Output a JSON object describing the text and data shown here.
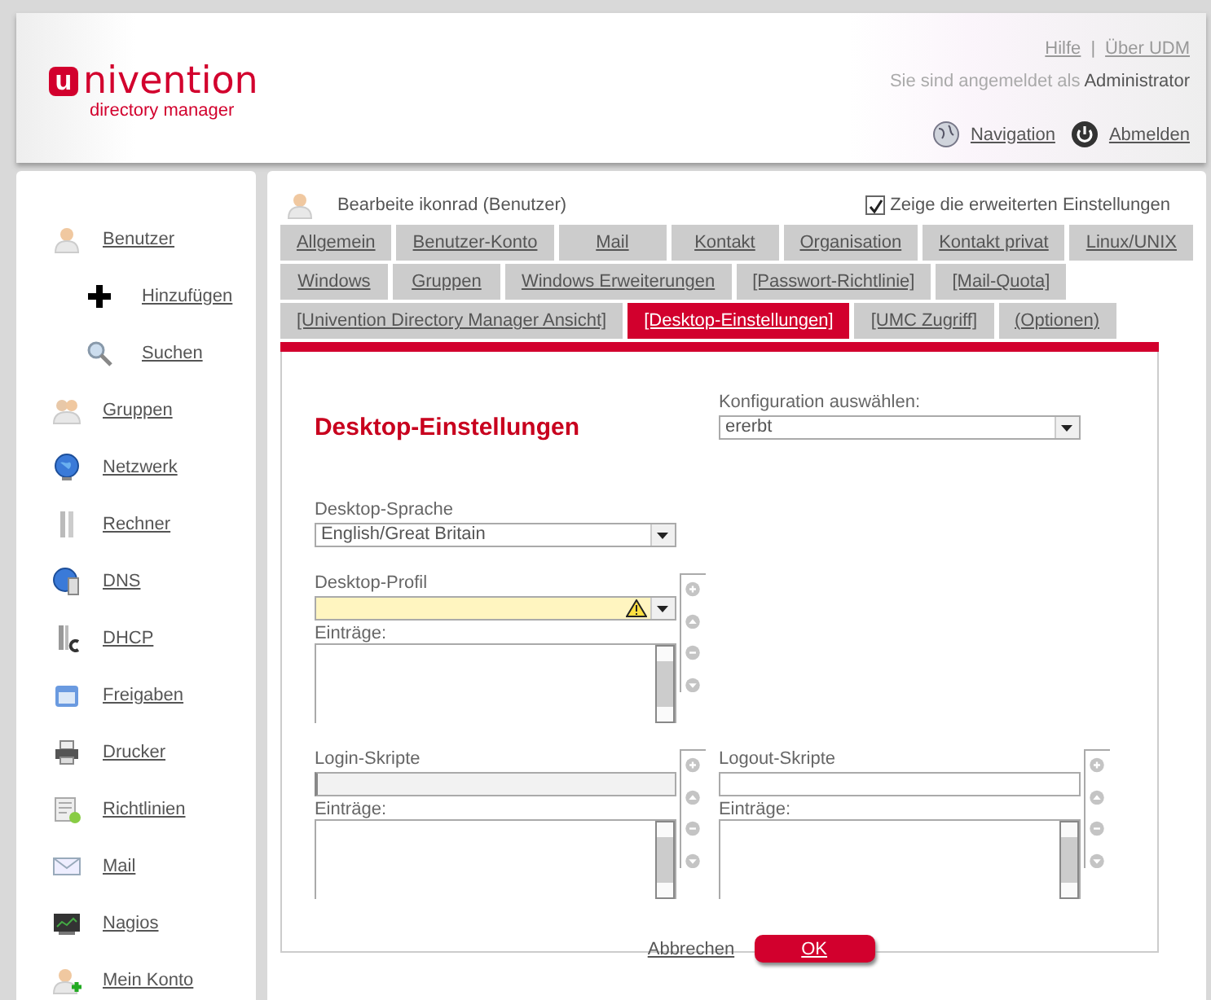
{
  "header": {
    "logo": {
      "mark": "u",
      "text": "nivention",
      "subtitle": "directory manager"
    },
    "links": [
      {
        "label": "Hilfe"
      },
      {
        "label": "Über UDM"
      }
    ],
    "separator": "|",
    "login_text": "Sie sind angemeldet als",
    "user": "Administrator",
    "actions": [
      {
        "label": "Navigation",
        "kind": "globe"
      },
      {
        "label": "Abmelden",
        "kind": "power"
      }
    ]
  },
  "sidebar": {
    "items": [
      {
        "label": "Benutzer",
        "kind": "user",
        "children": [
          {
            "label": "Hinzufügen",
            "kind": "plus"
          },
          {
            "label": "Suchen",
            "kind": "search"
          }
        ]
      },
      {
        "label": "Gruppen",
        "kind": "group"
      },
      {
        "label": "Netzwerk",
        "kind": "globe"
      },
      {
        "label": "Rechner",
        "kind": "server"
      },
      {
        "label": "DNS",
        "kind": "dns"
      },
      {
        "label": "DHCP",
        "kind": "dhcp"
      },
      {
        "label": "Freigaben",
        "kind": "share"
      },
      {
        "label": "Drucker",
        "kind": "printer"
      },
      {
        "label": "Richtlinien",
        "kind": "policy"
      },
      {
        "label": "Mail",
        "kind": "mail"
      },
      {
        "label": "Nagios",
        "kind": "monitor"
      },
      {
        "label": "Mein Konto",
        "kind": "useradd"
      }
    ]
  },
  "editor": {
    "title": "Bearbeite ikonrad (Benutzer)",
    "advanced": {
      "label": "Zeige die erweiterten Einstellungen",
      "checked": true
    },
    "tab_rows": [
      [
        {
          "label": "Allgemein",
          "selected": false
        },
        {
          "label": "Benutzer-Konto",
          "selected": false
        },
        {
          "label": "Mail",
          "selected": false
        },
        {
          "label": "Kontakt",
          "selected": false
        },
        {
          "label": "Organisation",
          "selected": false
        },
        {
          "label": "Kontakt privat",
          "selected": false
        },
        {
          "label": "Linux/UNIX",
          "selected": false
        }
      ],
      [
        {
          "label": "Windows",
          "selected": false
        },
        {
          "label": "Gruppen",
          "selected": false
        },
        {
          "label": "Windows Erweiterungen",
          "selected": false
        },
        {
          "label": "[Passwort-Richtlinie]",
          "selected": false
        },
        {
          "label": "[Mail-Quota]",
          "selected": false
        }
      ],
      [
        {
          "label": "[Univention Directory Manager Ansicht]",
          "selected": false
        },
        {
          "label": "[Desktop-Einstellungen]",
          "selected": true
        },
        {
          "label": "[UMC Zugriff]",
          "selected": false
        },
        {
          "label": "(Optionen)",
          "selected": false
        }
      ]
    ],
    "section_title": "Desktop-Einstellungen",
    "config": {
      "label": "Konfiguration auswählen:",
      "value": "ererbt"
    },
    "fields": [
      {
        "kind": "select",
        "label": "Desktop-Sprache",
        "value": "English/Great Britain"
      },
      {
        "kind": "combolist",
        "label": "Desktop-Profil",
        "invalid": true,
        "entries_label": "Einträge:"
      },
      {
        "kind": "textlist",
        "label": "Login-Skripte",
        "focused": true,
        "entries_label": "Einträge:"
      },
      {
        "kind": "textlist",
        "label": "Logout-Skripte",
        "focused": false,
        "entries_label": "Einträge:"
      }
    ],
    "buttons": {
      "cancel": "Abbrechen",
      "ok": "OK"
    }
  }
}
